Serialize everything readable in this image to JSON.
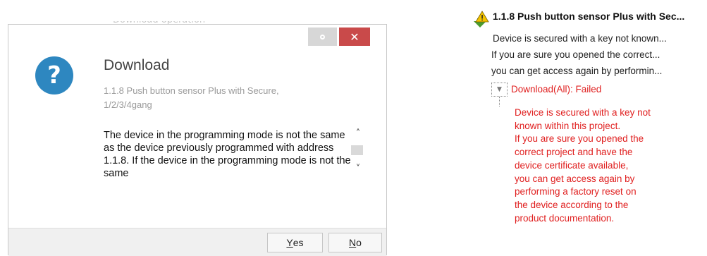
{
  "dialog": {
    "background_title": "Download operation",
    "minimize_glyph": "○",
    "close_glyph": "✕",
    "icon_glyph": "?",
    "title": "Download",
    "subtitle": "1.1.8 Push button sensor Plus with Secure, 1/2/3/4gang",
    "message": "The device in the programming mode is not the same as the device previously programmed with address 1.1.8. If the device in the programming mode is not the same",
    "scroll_up_glyph": "˄",
    "scroll_down_glyph": "˅",
    "yes_hotkey": "Y",
    "yes_rest": "es",
    "no_hotkey": "N",
    "no_rest": "o"
  },
  "panel": {
    "header": "1.1.8 Push button sensor Plus with Sec...",
    "lines": [
      "Device is secured with a key not known...",
      "If you are sure you opened the correct...",
      "you can get access again by performin..."
    ],
    "expander_glyph": "▼",
    "status": "Download(All): Failed",
    "detail_lines": [
      "Device is secured with a key not",
      "known within this project.",
      "If you are sure you opened the",
      "correct project and have the",
      "device certificate available,",
      "you can get access again by",
      "performing a factory reset on",
      "the device according to the",
      "product documentation."
    ]
  },
  "colors": {
    "accent_blue": "#2e87c0",
    "close_red": "#c94a4a",
    "error_red": "#e02020",
    "warning_yellow": "#f2c200",
    "download_green": "#4a9b2f"
  }
}
